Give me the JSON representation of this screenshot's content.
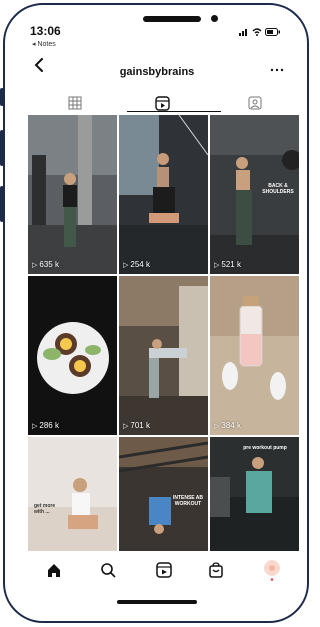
{
  "status_bar": {
    "time": "13:06",
    "back_app": "◂ Notes"
  },
  "header": {
    "username": "gainsbybrains"
  },
  "grid": {
    "tiles": [
      {
        "views": "635 k"
      },
      {
        "views": "254 k"
      },
      {
        "views": "521 k",
        "overlay": "BACK & SHOULDERS"
      },
      {
        "views": "286 k"
      },
      {
        "views": "701 k"
      },
      {
        "views": "384 k"
      },
      {
        "views": "",
        "overlay": "get more with ..."
      },
      {
        "views": "",
        "overlay": "INTENSE AB WORKOUT"
      },
      {
        "views": "",
        "overlay": "pre workout pump"
      }
    ]
  },
  "colors": {
    "frame": "#1d2a4a",
    "accent": "#e9445a"
  }
}
